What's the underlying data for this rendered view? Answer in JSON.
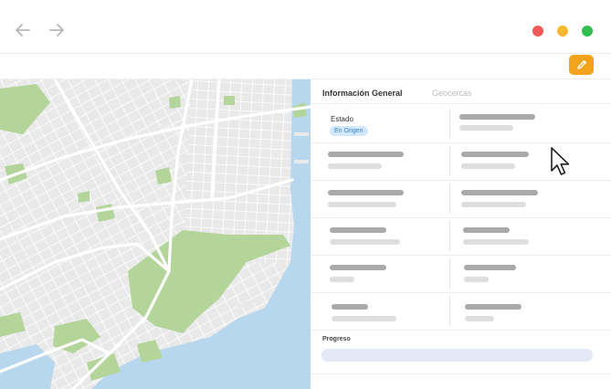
{
  "window": {
    "back_icon": "arrow-left-icon",
    "forward_icon": "arrow-right-icon",
    "controls": [
      {
        "name": "close",
        "color": "#ee5a57"
      },
      {
        "name": "minimize",
        "color": "#f3b82d"
      },
      {
        "name": "maximize",
        "color": "#2fc04f"
      }
    ]
  },
  "toolbar": {
    "edit_icon": "pencil-icon",
    "edit_color": "#f2a31b"
  },
  "map": {
    "water_color": "#b7d7ee",
    "park_color": "#b4d59a",
    "land_color": "#e9e9e9"
  },
  "panel": {
    "tabs": [
      {
        "label": "Información General",
        "active": true
      },
      {
        "label": "Geocercas",
        "active": false
      }
    ],
    "estado": {
      "label": "Estado",
      "badge": "En Origen"
    },
    "progress": {
      "label": "Progreso",
      "value": 1.0
    }
  },
  "cursor": "arrow-cursor-icon"
}
